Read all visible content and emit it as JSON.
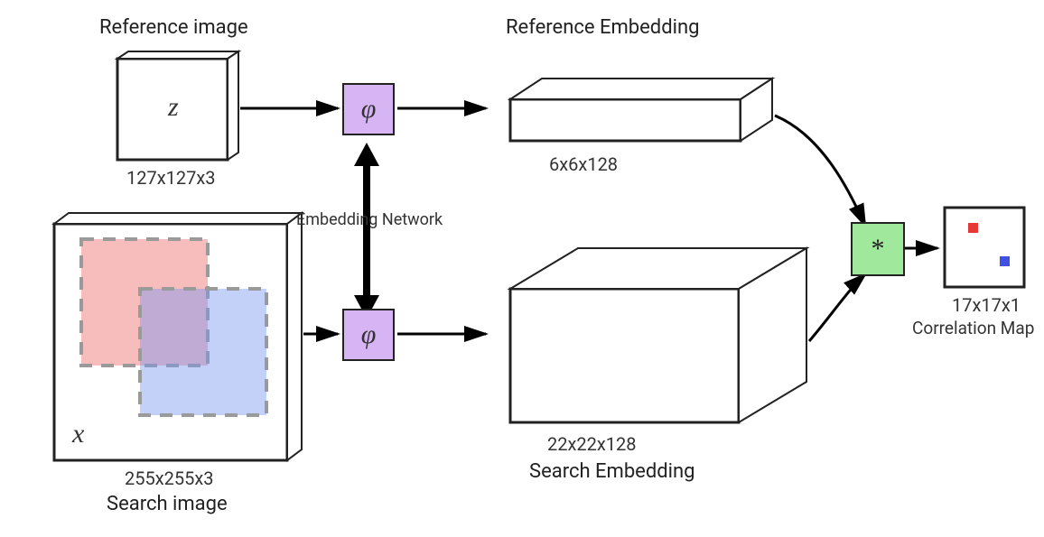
{
  "reference_image": {
    "title": "Reference image",
    "symbol": "z",
    "dims": "127x127x3"
  },
  "search_image": {
    "title": "Search image",
    "symbol": "x",
    "dims": "255x255x3"
  },
  "embedding_network": {
    "label": "Embedding Network",
    "phi_symbol_top": "φ",
    "phi_symbol_bottom": "φ"
  },
  "reference_embedding": {
    "title": "Reference Embedding",
    "dims": "6x6x128"
  },
  "search_embedding": {
    "title": "Search Embedding",
    "dims": "22x22x128"
  },
  "correlation_op": {
    "symbol": "*"
  },
  "correlation_map": {
    "dims": "17x17x1",
    "title": "Correlation Map"
  }
}
